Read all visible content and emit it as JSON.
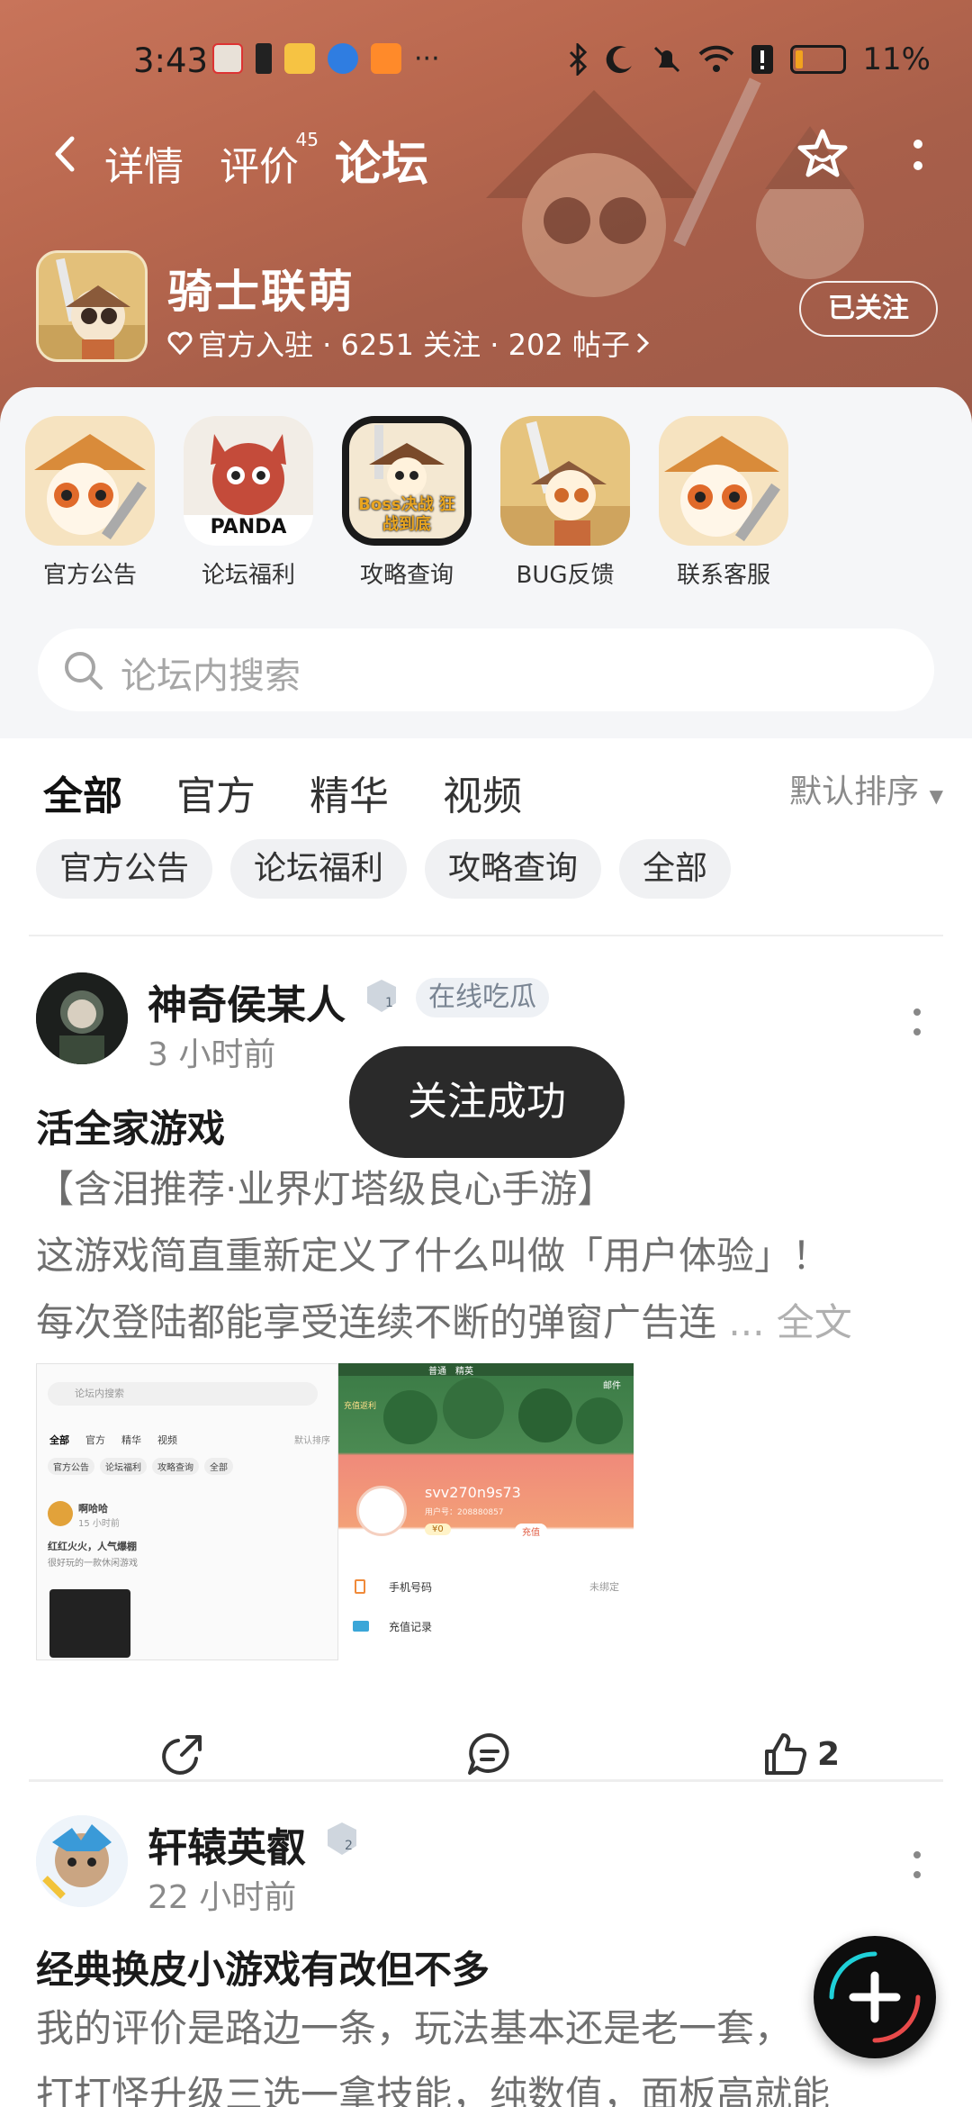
{
  "status_bar": {
    "time": "3:43",
    "battery": "11%"
  },
  "nav": {
    "tabs": [
      {
        "label": "详情",
        "active": false
      },
      {
        "label": "评价",
        "badge": "45",
        "active": false
      },
      {
        "label": "论坛",
        "active": true
      }
    ]
  },
  "game": {
    "title": "骑士联萌",
    "meta": "官方入驻 · 6251 关注 · 202 帖子",
    "follow_label": "已关注"
  },
  "shortcuts": [
    {
      "label": "官方公告",
      "icon": "bamboo-hat-hero-icon"
    },
    {
      "label": "论坛福利",
      "icon": "panda-dragon-icon",
      "art_text": "PANDA"
    },
    {
      "label": "攻略查询",
      "icon": "boss-guide-icon",
      "art_text": "Boss决战 狂战到底"
    },
    {
      "label": "BUG反馈",
      "icon": "sword-panda-icon"
    },
    {
      "label": "联系客服",
      "icon": "panda-sword-icon"
    }
  ],
  "search": {
    "placeholder": "论坛内搜索"
  },
  "content_tabs": [
    {
      "label": "全部",
      "active": true
    },
    {
      "label": "官方",
      "active": false
    },
    {
      "label": "精华",
      "active": false
    },
    {
      "label": "视频",
      "active": false
    }
  ],
  "sort_label": "默认排序",
  "chips": [
    "官方公告",
    "论坛福利",
    "攻略查询",
    "全部"
  ],
  "posts": [
    {
      "author": "神奇侯某人",
      "level": "1",
      "tag": "在线吃瓜",
      "time": "3 小时前",
      "title": "活全家游戏",
      "body_lines": [
        "【含泪推荐·业界灯塔级良心手游】",
        "这游戏简直重新定义了什么叫做「用户体验」！",
        "每次登陆都能享受连续不断的弹窗广告连"
      ],
      "more_label": "... 全文",
      "likes": "2",
      "shot1": {
        "search": "论坛内搜索",
        "tabs": [
          "全部",
          "官方",
          "精华",
          "视频"
        ],
        "sort": "默认排序",
        "chips": [
          "官方公告",
          "论坛福利",
          "攻略查询",
          "全部"
        ],
        "user": "啊哈哈",
        "time": "15 小时前",
        "title": "红红火火，人气爆棚",
        "body": "很好玩的一款休闲游戏"
      },
      "shot2": {
        "username": "svv270n9s73",
        "uid": "用户号：208880857",
        "coins": "¥0",
        "recharge": "充值",
        "phone_label": "手机号码",
        "phone_status": "未绑定",
        "record_label": "充值记录",
        "top_tabs": [
          "普通",
          "精英"
        ],
        "mail": "邮件",
        "side_label": "充值返利"
      }
    },
    {
      "author": "轩辕英叡",
      "level": "2",
      "time": "22 小时前",
      "title": "经典换皮小游戏有改但不多",
      "body_lines": [
        "我的评价是路边一条，玩法基本还是老一套，",
        "打打怪升级三选一拿技能，纯数值，面板高就能"
      ]
    }
  ],
  "toast": "关注成功",
  "colors": {
    "accent": "#15c5ce",
    "hero": "#b8674e"
  }
}
